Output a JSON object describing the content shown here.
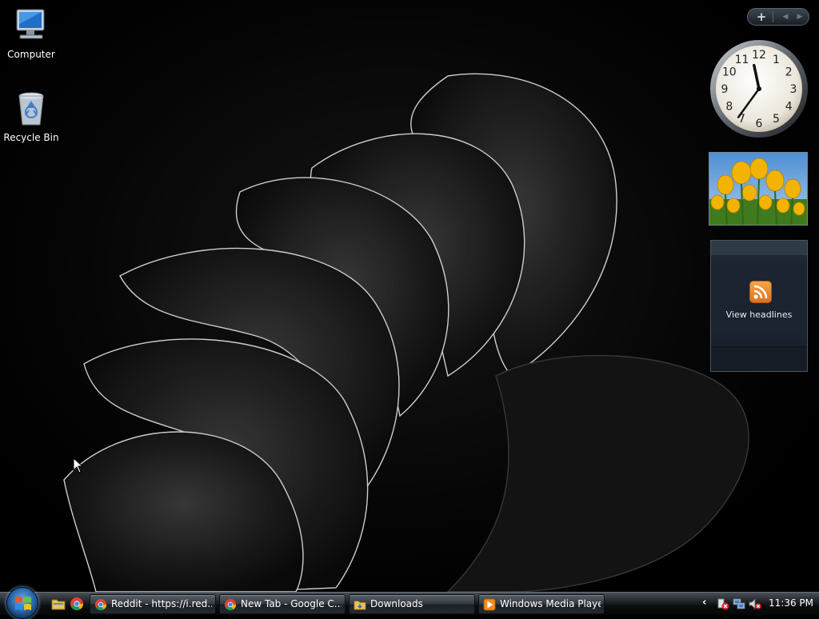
{
  "desktop": {
    "icons": [
      {
        "label": "Computer",
        "icon": "computer-icon"
      },
      {
        "label": "Recycle Bin",
        "icon": "recycle-bin-icon"
      }
    ]
  },
  "sidebar": {
    "controls": {
      "add": "+",
      "prev": "◀",
      "next": "▶"
    },
    "clock": {
      "hour": 11,
      "minute": 36,
      "numerals": [
        "12",
        "1",
        "2",
        "3",
        "4",
        "5",
        "6",
        "7",
        "8",
        "9",
        "10",
        "11"
      ]
    },
    "slideshow": {
      "subject": "yellow tulips",
      "sky_color": "#7fb3e6",
      "flower_color": "#f2b400"
    },
    "feed": {
      "caption": "View headlines",
      "icon": "rss-icon"
    }
  },
  "taskbar": {
    "start": {
      "icon": "windows-logo-icon"
    },
    "quick_launch": [
      {
        "icon": "folder-icon"
      },
      {
        "icon": "chrome-icon"
      }
    ],
    "tasks": [
      {
        "label": "Reddit - https://i.red...",
        "icon": "chrome-icon"
      },
      {
        "label": "New Tab - Google C...",
        "icon": "chrome-icon"
      },
      {
        "label": "Downloads",
        "icon": "folder-icon"
      },
      {
        "label": "Windows Media Player",
        "icon": "media-player-icon"
      }
    ],
    "tray": {
      "chevron": "‹",
      "icons": [
        "security-alert-icon",
        "network-icon",
        "volume-muted-icon"
      ],
      "time": "11:36 PM"
    }
  },
  "colors": {
    "taskbar": "#1a1d21",
    "accent": "#2a6db2",
    "feed_orange": "#e8851f"
  }
}
